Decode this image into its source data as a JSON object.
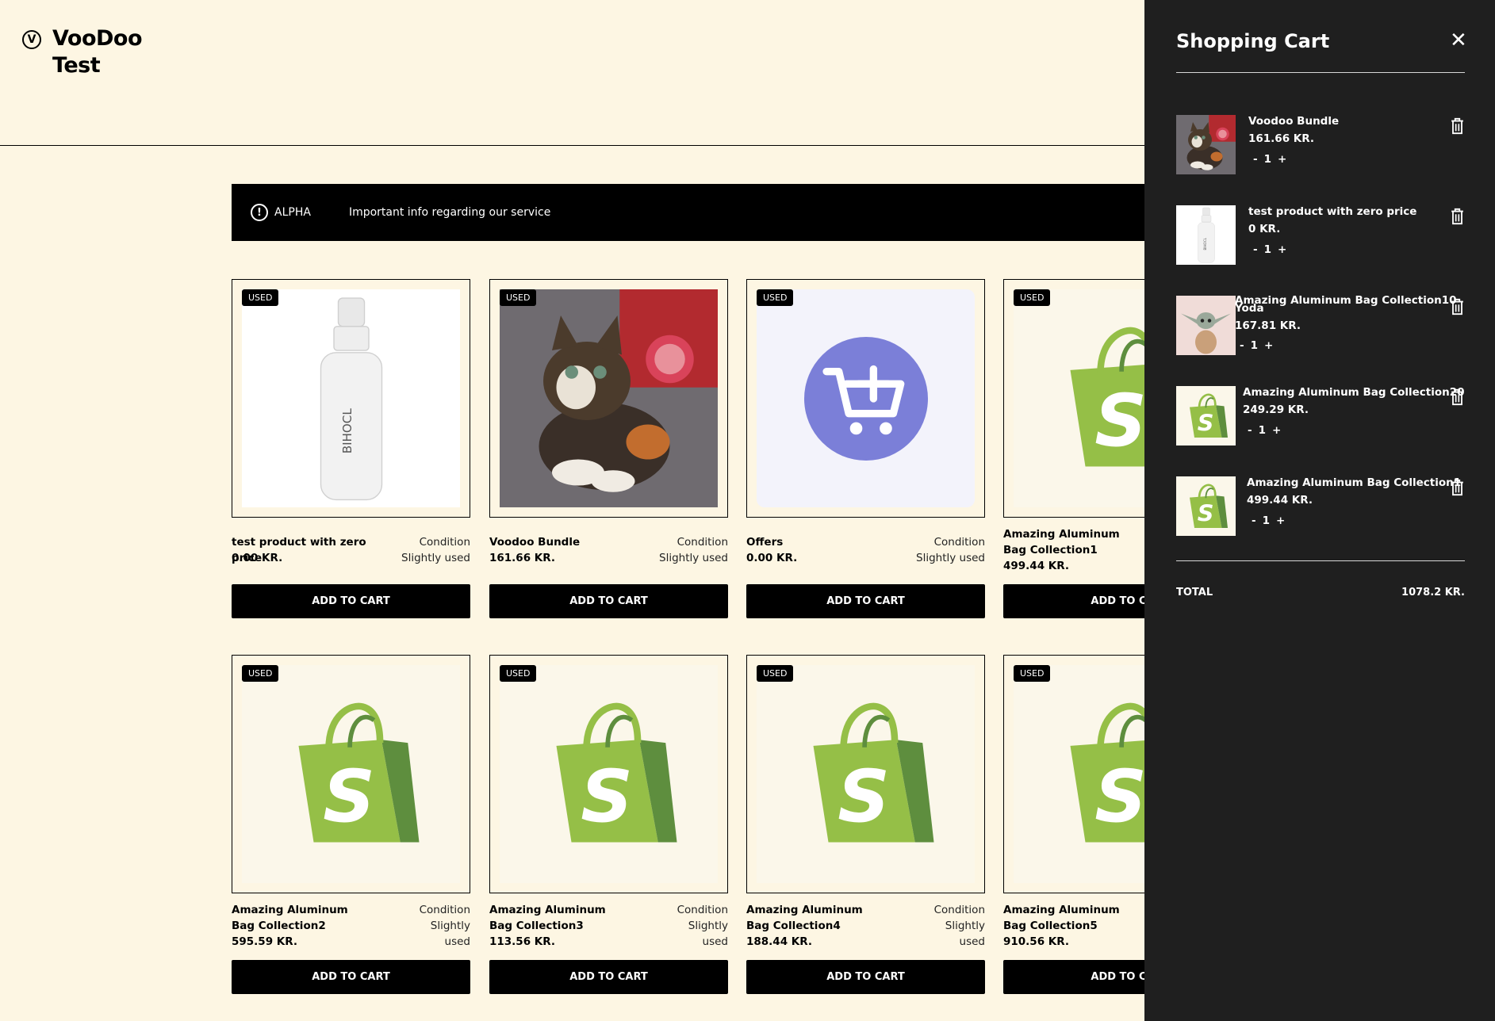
{
  "brand": {
    "mark": "V",
    "name_line1": "VooDoo",
    "name_line2": "Test"
  },
  "banner": {
    "tag": "ALPHA",
    "text": "Important info regarding our service"
  },
  "products": [
    {
      "badge": "USED",
      "name": "test product with zero price",
      "price": "0.00 KR.",
      "condition_label": "Condition",
      "condition_value": "Slightly used",
      "button": "ADD TO CART",
      "image": "spray-bottle"
    },
    {
      "badge": "USED",
      "name": "Voodoo Bundle",
      "price": "161.66 KR.",
      "condition_label": "Condition",
      "condition_value": "Slightly used",
      "button": "ADD TO CART",
      "image": "kitten-photo"
    },
    {
      "badge": "USED",
      "name": "Offers",
      "price": "0.00 KR.",
      "condition_label": "Condition",
      "condition_value": "Slightly used",
      "button": "ADD TO CART",
      "image": "cart-plus-icon"
    },
    {
      "badge": "USED",
      "name": "Amazing Aluminum Bag Collection1",
      "price": "499.44 KR.",
      "condition_label": "",
      "condition_value": "",
      "button": "ADD TO CA",
      "image": "shopify-bag-icon"
    },
    {
      "badge": "USED",
      "name": "Amazing Aluminum Bag Collection2",
      "price": "595.59 KR.",
      "condition_label": "Condition",
      "condition_value": "Slightly used",
      "button": "ADD TO CART",
      "image": "shopify-bag-icon"
    },
    {
      "badge": "USED",
      "name": "Amazing Aluminum Bag Collection3",
      "price": "113.56 KR.",
      "condition_label": "Condition",
      "condition_value": "Slightly used",
      "button": "ADD TO CART",
      "image": "shopify-bag-icon"
    },
    {
      "badge": "USED",
      "name": "Amazing Aluminum Bag Collection4",
      "price": "188.44 KR.",
      "condition_label": "Condition",
      "condition_value": "Slightly used",
      "button": "ADD TO CART",
      "image": "shopify-bag-icon"
    },
    {
      "badge": "USED",
      "name": "Amazing Aluminum Bag Collection5",
      "price": "910.56 KR.",
      "condition_label": "",
      "condition_value": "",
      "button": "ADD TO CA",
      "image": "shopify-bag-icon"
    }
  ],
  "cart": {
    "title": "Shopping Cart",
    "close_icon": "close-icon",
    "items": [
      {
        "name": "Voodoo Bundle",
        "price": "161.66 KR.",
        "minus": "-",
        "qty": "1",
        "plus": "+",
        "image": "kitten-photo"
      },
      {
        "name": "test product with zero price",
        "price": "0 KR.",
        "minus": "-",
        "qty": "1",
        "plus": "+",
        "image": "spray-bottle"
      },
      {
        "name": "Amazing Aluminum Bag Collection10",
        "sub": "Yoda",
        "price": "167.81 KR.",
        "minus": "-",
        "qty": "1",
        "plus": "+",
        "image": "yoda-figure"
      },
      {
        "name": "Amazing Aluminum Bag Collection20",
        "price": "249.29 KR.",
        "minus": "-",
        "qty": "1",
        "plus": "+",
        "image": "shopify-bag-icon"
      },
      {
        "name": "Amazing Aluminum Bag Collection1",
        "price": "499.44 KR.",
        "minus": "-",
        "qty": "1",
        "plus": "+",
        "image": "shopify-bag-icon"
      }
    ],
    "total_label": "TOTAL",
    "total_value": "1078.2 KR."
  },
  "colors": {
    "page_bg": "#fdf6e3",
    "cart_bg": "#1f1f1f",
    "button_bg": "#000000",
    "shopify_green": "#95bf47",
    "offer_purple": "#7b7fd8"
  }
}
